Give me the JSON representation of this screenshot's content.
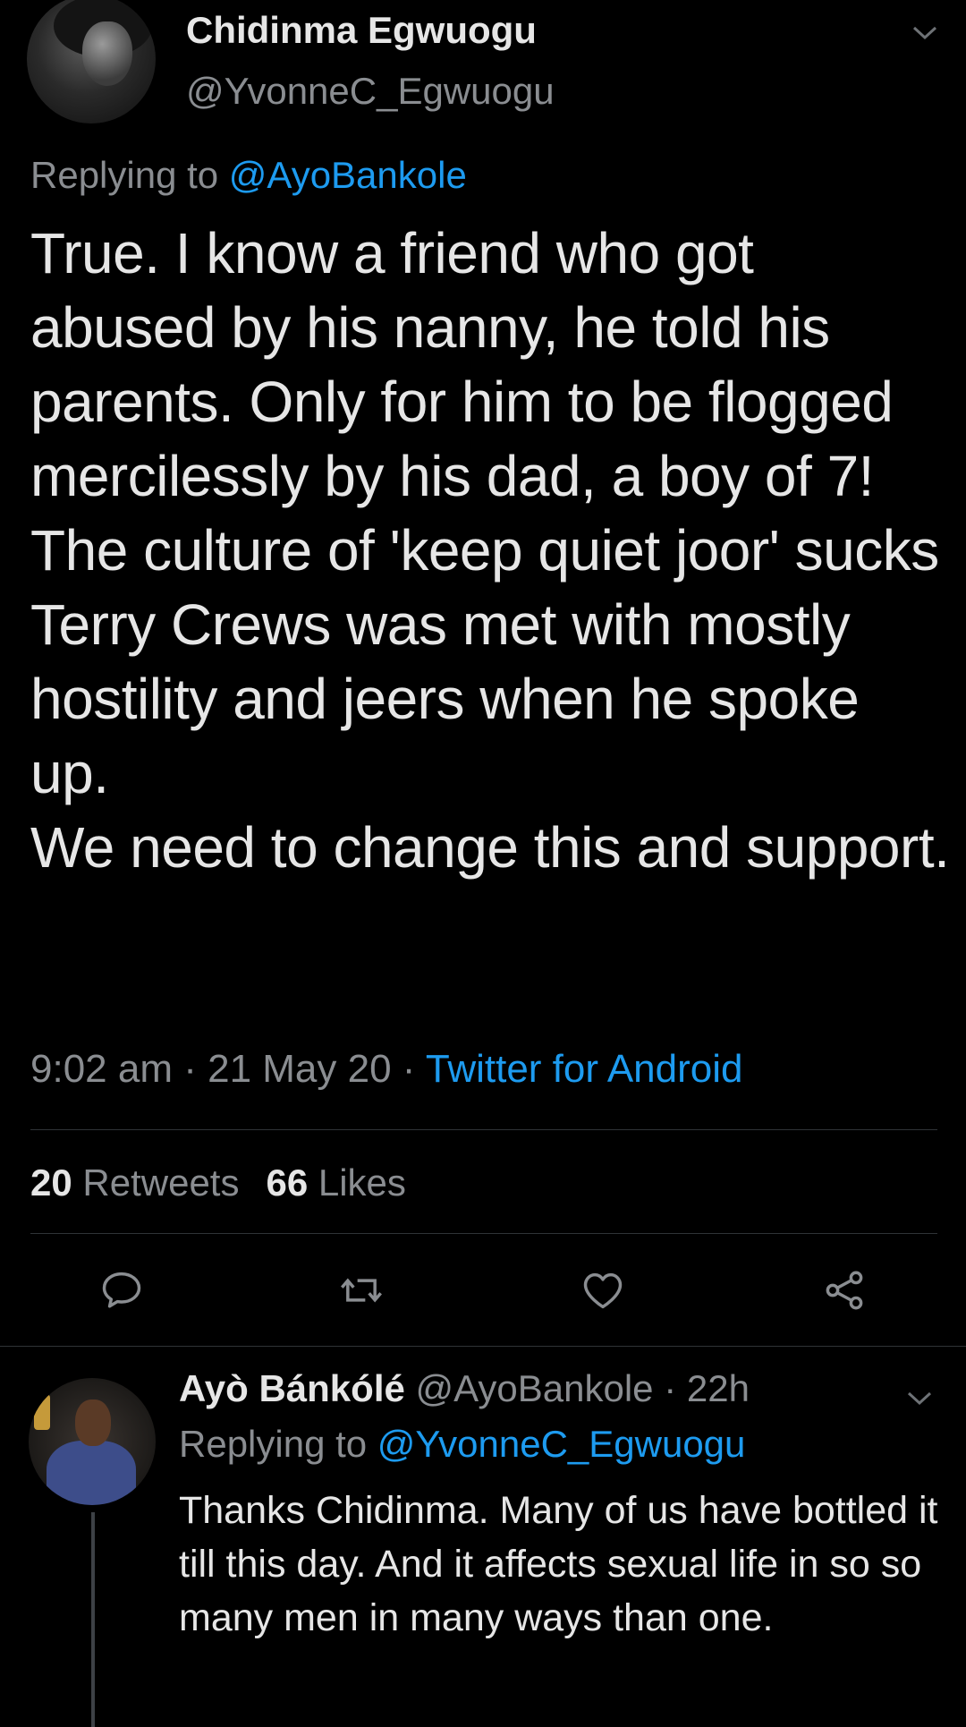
{
  "main_tweet": {
    "display_name": "Chidinma Egwuogu",
    "handle": "@YvonneC_Egwuogu",
    "replying_to_prefix": "Replying to",
    "replying_to_handle": "@AyoBankole",
    "text": "True. I know a friend who got abused by his nanny, he told his parents. Only for him to be flogged mercilessly by his dad, a boy of 7!\nThe culture of 'keep quiet joor' sucks\nTerry Crews was met with mostly hostility and jeers when he spoke up.\nWe need to change this and support.",
    "time": "9:02 am",
    "date": "21 May 20",
    "source": "Twitter for Android",
    "retweets_count": "20",
    "retweets_label": "Retweets",
    "likes_count": "66",
    "likes_label": "Likes"
  },
  "actions": [
    {
      "name": "reply",
      "icon": "reply-icon"
    },
    {
      "name": "retweet",
      "icon": "retweet-icon"
    },
    {
      "name": "like",
      "icon": "heart-icon"
    },
    {
      "name": "share",
      "icon": "share-icon"
    }
  ],
  "reply_tweet": {
    "display_name": "Ayò Bánkólé",
    "handle": "@AyoBankole",
    "time_ago": "22h",
    "replying_to_prefix": "Replying to",
    "replying_to_handle": "@YvonneC_Egwuogu",
    "text": "Thanks Chidinma. Many of us have bottled it till this day. And it affects sexual life in so so many men in many ways than one."
  },
  "colors": {
    "background": "#000000",
    "text": "#e6e6e6",
    "muted": "#8a8d91",
    "link": "#1d9bf0",
    "divider": "#2f3336"
  }
}
